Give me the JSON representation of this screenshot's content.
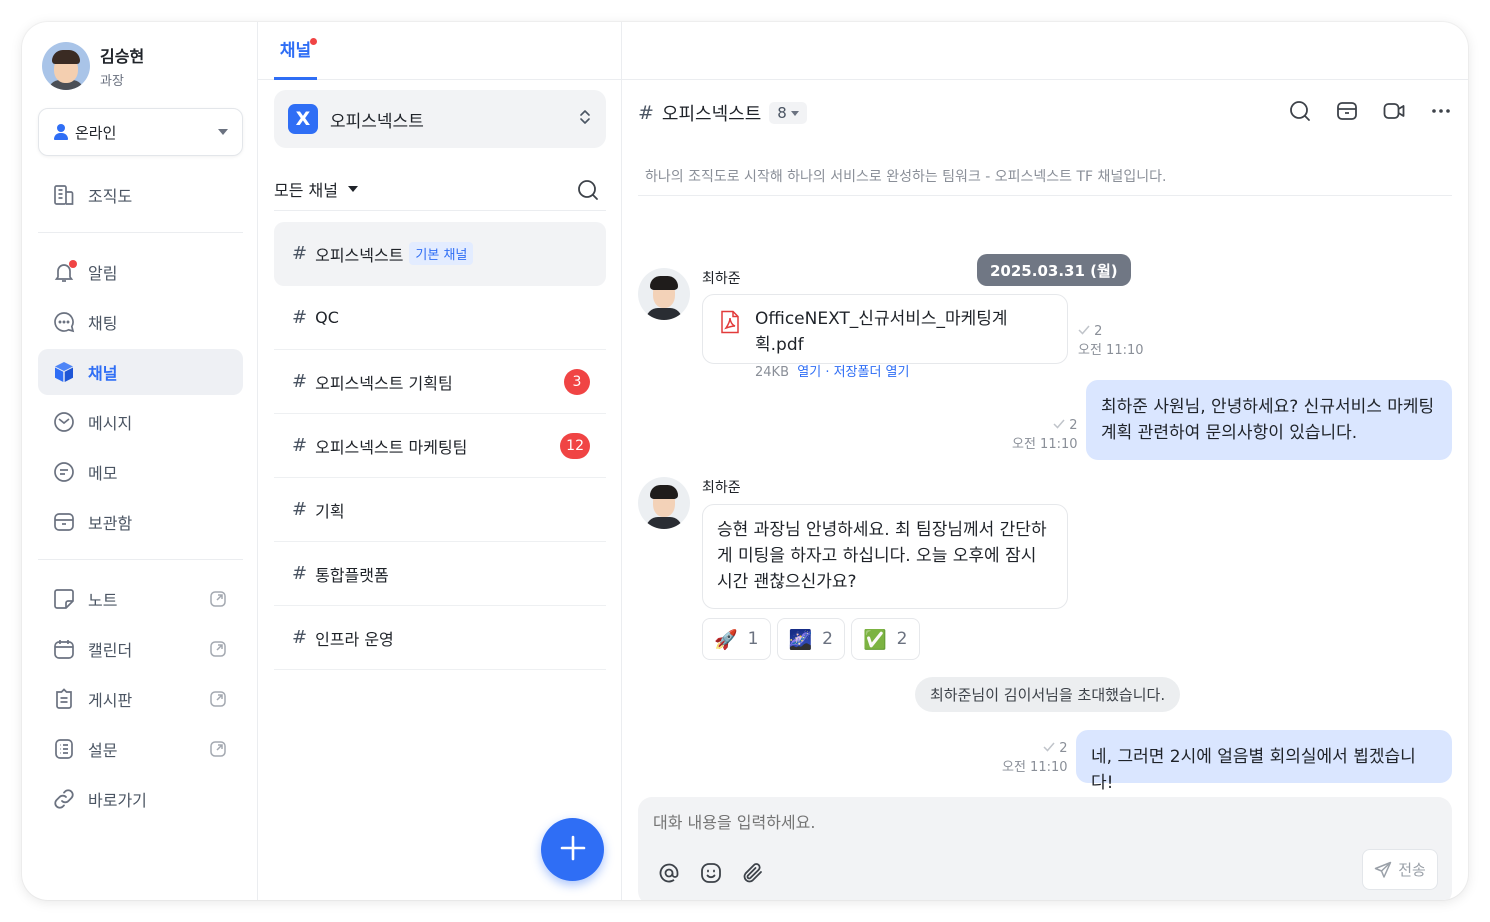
{
  "profile": {
    "name": "김승현",
    "title": "과장"
  },
  "status": {
    "label": "온라인"
  },
  "nav": {
    "org": "조직도",
    "alarm": "알림",
    "chat": "채팅",
    "channel": "채널",
    "message": "메시지",
    "memo": "메모",
    "storage": "보관함",
    "note": "노트",
    "calendar": "캘린더",
    "board": "게시판",
    "survey": "설문",
    "shortcut": "바로가기"
  },
  "tab": {
    "label": "채널"
  },
  "workspace": {
    "logo": "X",
    "name": "오피스넥스트"
  },
  "filter": {
    "label": "모든 채널"
  },
  "channels": [
    {
      "name": "오피스넥스트",
      "chip": "기본 채널"
    },
    {
      "name": "QC"
    },
    {
      "name": "오피스넥스트 기획팀",
      "badge": "3"
    },
    {
      "name": "오피스넥스트 마케팅팀",
      "badge": "12"
    },
    {
      "name": "기획"
    },
    {
      "name": "통합플랫폼"
    },
    {
      "name": "인프라 운영"
    }
  ],
  "chat": {
    "hash": "#",
    "title": "오피스넥스트",
    "member_count": "8",
    "description": "하나의 조직도로 시작해 하나의 서비스로 완성하는 팀워크 - 오피스넥스트 TF 채널입니다.",
    "date": "2025.03.31 (월)",
    "messages": [
      {
        "sender": "최하준",
        "file_name": "OfficeNEXT_신규서비스_마케팅계획.pdf",
        "file_size": "24KB",
        "file_actions": "열기 · 저장폴더 열기",
        "read_count": "2",
        "time": "오전 11:10"
      },
      {
        "text": "최하준 사원님, 안녕하세요? 신규서비스 마케팅 계획 관련하여 문의사항이 있습니다.",
        "read_count": "2",
        "time": "오전 11:10"
      },
      {
        "sender": "최하준",
        "text": "승현 과장님 안녕하세요. 최 팀장님께서 간단하게 미팅을 하자고 하십니다. 오늘 오후에 잠시 시간 괜찮으신가요?"
      },
      {
        "text": "네, 그러면 2시에 얼음별 회의실에서 뵙겠습니다!",
        "read_count": "2",
        "time": "오전 11:10"
      }
    ],
    "reactions": [
      {
        "emoji": "🚀",
        "count": "1"
      },
      {
        "emoji": "🌌",
        "count": "2"
      },
      {
        "emoji": "✅",
        "count": "2"
      }
    ],
    "system_message": "최하준님이 김이서님을 초대했습니다."
  },
  "composer": {
    "placeholder": "대화 내용을 입력하세요.",
    "send_label": "전송"
  },
  "colors": {
    "accent": "#2f6ef5",
    "badge": "#f04444",
    "my_bubble": "#dae6ff"
  }
}
